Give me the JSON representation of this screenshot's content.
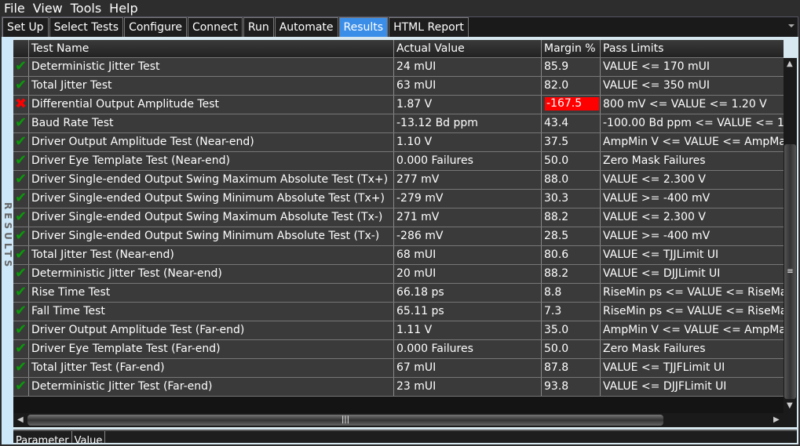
{
  "menu": [
    "File",
    "View",
    "Tools",
    "Help"
  ],
  "tabs": [
    "Set Up",
    "Select Tests",
    "Configure",
    "Connect",
    "Run",
    "Automate",
    "Results",
    "HTML Report"
  ],
  "active_tab": "Results",
  "side_label": "RESULTS",
  "columns": [
    "",
    "Test Name",
    "Actual Value",
    "Margin %",
    "Pass Limits"
  ],
  "rows": [
    {
      "status": "pass",
      "name": "Deterministic Jitter Test",
      "actual": "24 mUI",
      "margin": "85.9",
      "limits": "VALUE <= 170 mUI"
    },
    {
      "status": "pass",
      "name": "Total Jitter Test",
      "actual": "63 mUI",
      "margin": "82.0",
      "limits": "VALUE <= 350 mUI"
    },
    {
      "status": "fail",
      "name": "Differential Output Amplitude Test",
      "actual": "1.87 V",
      "margin": "-167.5",
      "limits": "800 mV <= VALUE <= 1.20 V"
    },
    {
      "status": "pass",
      "name": "Baud Rate Test",
      "actual": "-13.12 Bd ppm",
      "margin": "43.4",
      "limits": "-100.00 Bd ppm <= VALUE <= 1"
    },
    {
      "status": "pass",
      "name": "Driver Output Amplitude Test (Near-end)",
      "actual": "1.10 V",
      "margin": "37.5",
      "limits": "AmpMin V <= VALUE <= AmpMa"
    },
    {
      "status": "pass",
      "name": "Driver Eye Template Test (Near-end)",
      "actual": "0.000 Failures",
      "margin": "50.0",
      "limits": "Zero Mask Failures"
    },
    {
      "status": "pass",
      "name": "Driver Single-ended Output Swing Maximum Absolute Test (Tx+)",
      "actual": "277 mV",
      "margin": "88.0",
      "limits": "VALUE <= 2.300 V"
    },
    {
      "status": "pass",
      "name": "Driver Single-ended Output Swing Minimum Absolute Test (Tx+)",
      "actual": "-279 mV",
      "margin": "30.3",
      "limits": "VALUE >= -400 mV"
    },
    {
      "status": "pass",
      "name": "Driver Single-ended Output Swing Maximum Absolute Test (Tx-)",
      "actual": "271 mV",
      "margin": "88.2",
      "limits": "VALUE <= 2.300 V"
    },
    {
      "status": "pass",
      "name": "Driver Single-ended Output Swing Minimum Absolute Test (Tx-)",
      "actual": "-286 mV",
      "margin": "28.5",
      "limits": "VALUE >= -400 mV"
    },
    {
      "status": "pass",
      "name": "Total Jitter Test (Near-end)",
      "actual": "68 mUI",
      "margin": "80.6",
      "limits": "VALUE <= TJJLimit UI"
    },
    {
      "status": "pass",
      "name": "Deterministic Jitter Test (Near-end)",
      "actual": "20 mUI",
      "margin": "88.2",
      "limits": "VALUE <= DJJLimit UI"
    },
    {
      "status": "pass",
      "name": "Rise Time Test",
      "actual": "66.18 ps",
      "margin": "8.8",
      "limits": "RiseMin ps <= VALUE <= RiseMa"
    },
    {
      "status": "pass",
      "name": "Fall Time Test",
      "actual": "65.11 ps",
      "margin": "7.3",
      "limits": "RiseMin ps <= VALUE <= RiseMa"
    },
    {
      "status": "pass",
      "name": "Driver Output Amplitude Test (Far-end)",
      "actual": "1.11 V",
      "margin": "35.0",
      "limits": "AmpMin V <= VALUE <= AmpMa"
    },
    {
      "status": "pass",
      "name": "Driver Eye Template Test (Far-end)",
      "actual": "0.000 Failures",
      "margin": "50.0",
      "limits": "Zero Mask Failures"
    },
    {
      "status": "pass",
      "name": "Total Jitter Test (Far-end)",
      "actual": "67 mUI",
      "margin": "87.8",
      "limits": "VALUE <= TJJFLimit UI"
    },
    {
      "status": "pass",
      "name": "Deterministic Jitter Test (Far-end)",
      "actual": "23 mUI",
      "margin": "93.8",
      "limits": "VALUE <= DJJFLimit UI"
    }
  ],
  "bottom_columns": [
    "Parameter",
    "Value"
  ],
  "colors": {
    "pass": "#0a9a0a",
    "fail": "#ff0000",
    "active_tab": "#3b8ee8"
  }
}
